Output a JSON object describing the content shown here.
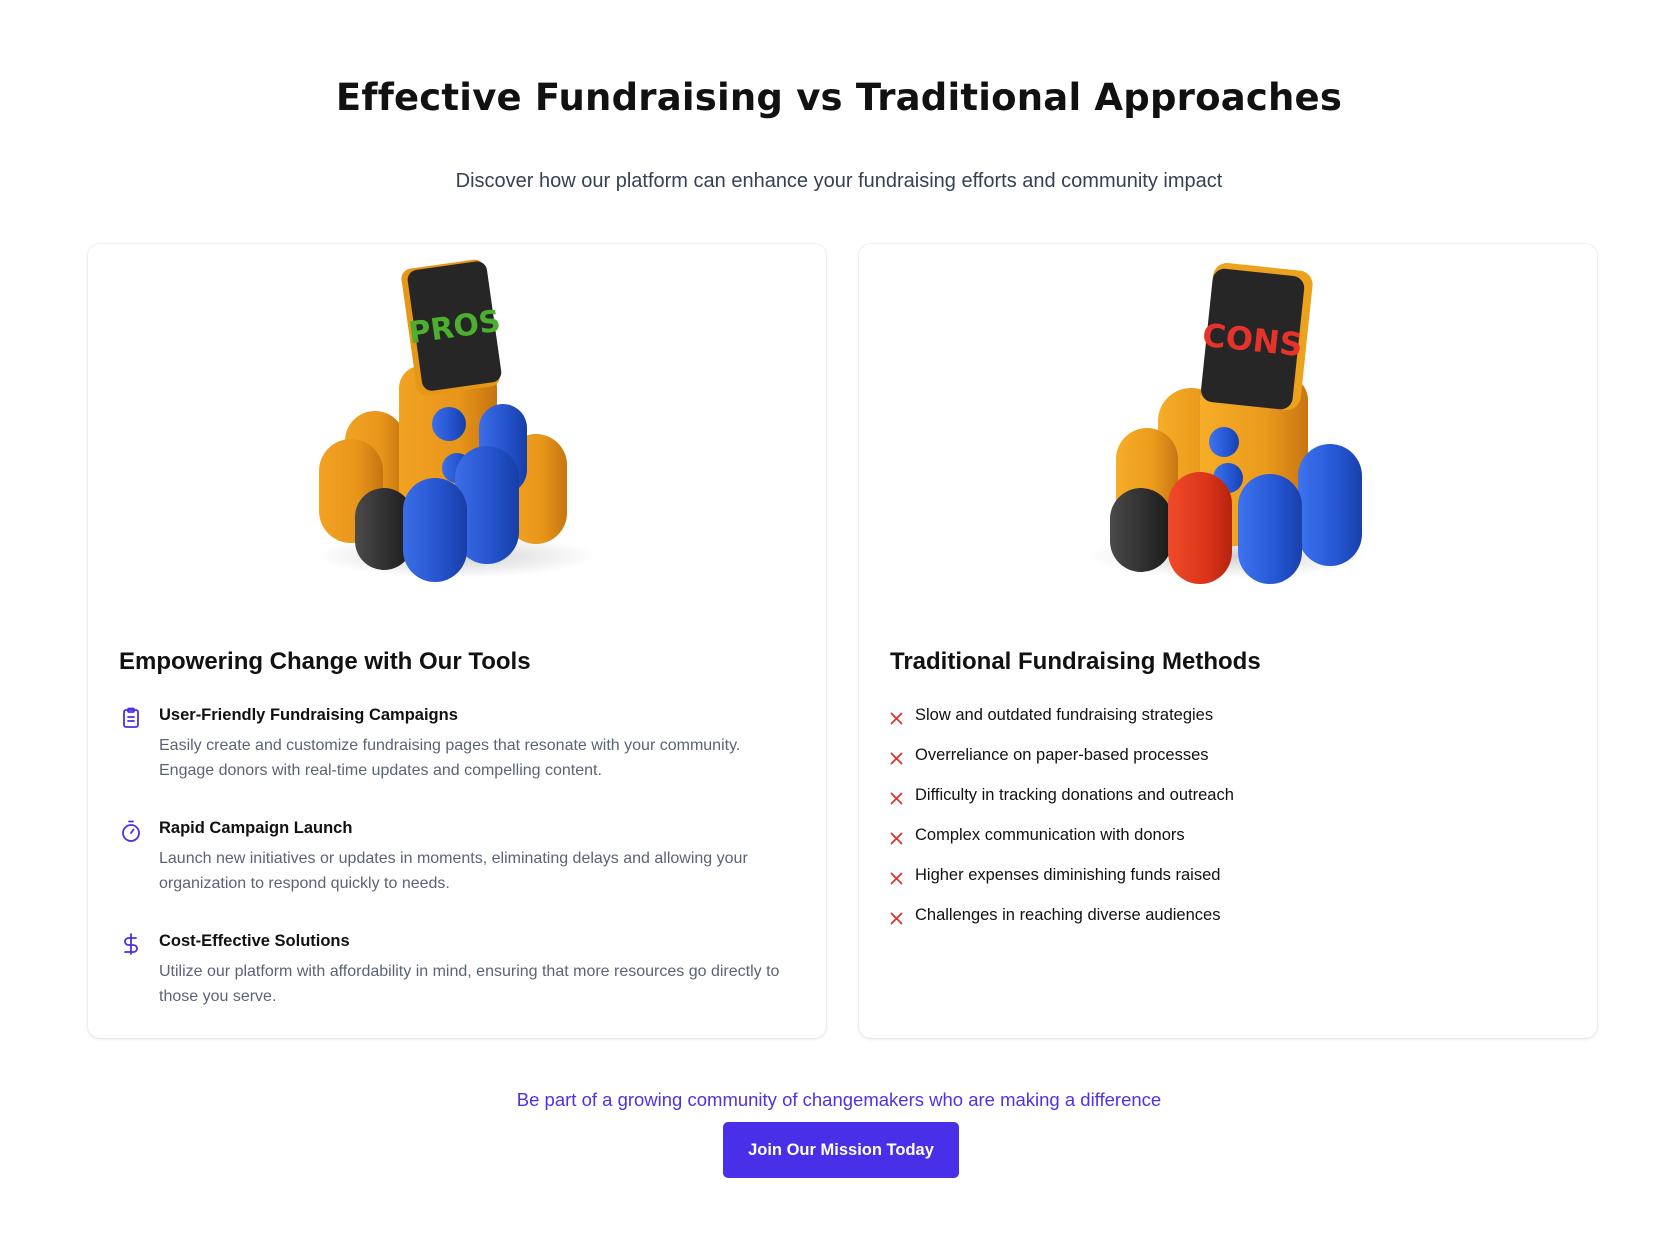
{
  "header": {
    "title": "Effective Fundraising vs Traditional Approaches",
    "subtitle": "Discover how our platform can enhance your fundraising efforts and community impact"
  },
  "pros_card": {
    "sign_text": "PROS",
    "heading": "Empowering Change with Our Tools",
    "features": [
      {
        "icon": "clipboard-icon",
        "title": "User-Friendly Fundraising Campaigns",
        "description": "Easily create and customize fundraising pages that resonate with your community. Engage donors with real-time updates and compelling content."
      },
      {
        "icon": "stopwatch-icon",
        "title": "Rapid Campaign Launch",
        "description": "Launch new initiatives or updates in moments, eliminating delays and allowing your organization to respond quickly to needs."
      },
      {
        "icon": "dollar-icon",
        "title": "Cost-Effective Solutions",
        "description": "Utilize our platform with affordability in mind, ensuring that more resources go directly to those you serve."
      }
    ]
  },
  "cons_card": {
    "sign_text": "CONS",
    "heading": "Traditional Fundraising Methods",
    "items": [
      "Slow and outdated fundraising strategies",
      "Overreliance on paper-based processes",
      "Difficulty in tracking donations and outreach",
      "Complex communication with donors",
      "Higher expenses diminishing funds raised",
      "Challenges in reaching diverse audiences"
    ]
  },
  "cta": {
    "text": "Be part of a growing community of changemakers who are making a difference",
    "button_label": "Join Our Mission Today"
  },
  "colors": {
    "accent": "#4a2fe8",
    "cons_x": "#e0352b",
    "pros_sign_text": "#4caf2f",
    "cons_sign_text": "#e5322b"
  }
}
